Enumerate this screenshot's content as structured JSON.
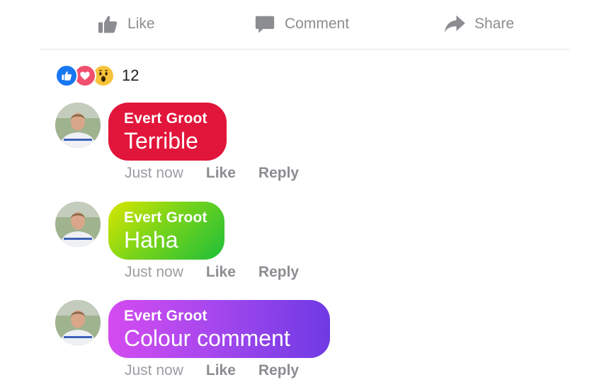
{
  "action_bar": {
    "like_label": "Like",
    "comment_label": "Comment",
    "share_label": "Share",
    "icon_color": "#8b8d91"
  },
  "reactions": {
    "types": [
      "like-icon",
      "love-icon",
      "wow-icon"
    ],
    "count": "12"
  },
  "comments": [
    {
      "author": "Evert Groot",
      "text": "Terrible",
      "time": "Just now",
      "like_label": "Like",
      "reply_label": "Reply",
      "bubble_color": "#e2153a"
    },
    {
      "author": "Evert Groot",
      "text": "Haha",
      "time": "Just now",
      "like_label": "Like",
      "reply_label": "Reply",
      "bubble_color": "gradient yellow-green"
    },
    {
      "author": "Evert Groot",
      "text": "Colour comment",
      "time": "Just now",
      "like_label": "Like",
      "reply_label": "Reply",
      "bubble_color": "gradient pink-purple"
    }
  ]
}
